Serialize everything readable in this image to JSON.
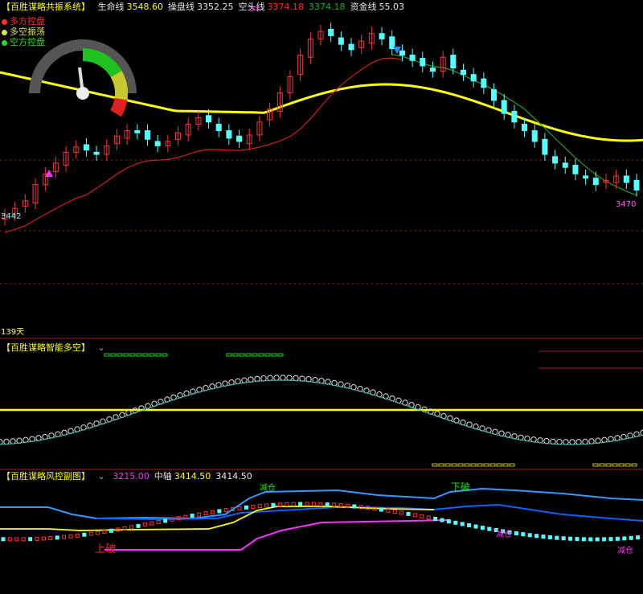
{
  "colors": {
    "up": "#ff3232",
    "down": "#54ffff",
    "life": "#ff3232",
    "op": "#e8e8e8",
    "short": "#ff3232",
    "money": "#00d000",
    "yellow": "#ffff00",
    "fund": "#20c020",
    "mag": "#ff30ff",
    "blue": "#1060ff",
    "lblue": "#3399ff",
    "grid": "#ff3232"
  },
  "main": {
    "title": "【百胜谋略共振系统】",
    "indicators": [
      {
        "name": "生命线",
        "value": "3548.60",
        "color": "#ffff00"
      },
      {
        "name": "操盘线",
        "value": "3352.25",
        "color": "#e8e8e8"
      },
      {
        "name": "空头线",
        "value": "3374.18",
        "color": "#ff3232"
      },
      {
        "name": "",
        "value": "3374.18",
        "color": "#00c000"
      },
      {
        "name": "资金线",
        "value": "55.03",
        "color": "#e8e8e8"
      }
    ],
    "legend": [
      {
        "label": "多方控盘",
        "color": "#ff3030",
        "dot": "#ff3030"
      },
      {
        "label": "多空振荡",
        "color": "#e0e060",
        "dot": "#e0e060"
      },
      {
        "label": "空方控盘",
        "color": "#20e020",
        "dot": "#20e020"
      }
    ],
    "low_label": "3442",
    "high_label": "3470",
    "peak_mark": "3↓",
    "days_label": "139天"
  },
  "sub1": {
    "title": "【百胜谋略智能多空】"
  },
  "sub2": {
    "title": "【百胜谋略风控副图】",
    "indicators": [
      {
        "name": "",
        "value": "3215.00",
        "color": "#ff30ff"
      },
      {
        "name": "中轴",
        "value": "3414.50",
        "color": "#ffff00"
      },
      {
        "name": "",
        "value": "3414.50",
        "color": "#e8e8e8"
      }
    ],
    "annotations": [
      {
        "text": "上破",
        "color": "#ff2020"
      },
      {
        "text": "减仓",
        "color": "#20e020"
      },
      {
        "text": "下破",
        "color": "#20e020"
      },
      {
        "text": "减仓",
        "color": "#ff30ff"
      },
      {
        "text": "减仓",
        "color": "#ff30ff"
      }
    ]
  },
  "chart_data": {
    "type": "candlestick",
    "days": "139天",
    "candles_close_trend": [
      3442,
      3448,
      3455,
      3470,
      3480,
      3490,
      3500,
      3505,
      3502,
      3498,
      3506,
      3515,
      3520,
      3518,
      3512,
      3506,
      3510,
      3518,
      3526,
      3532,
      3528,
      3520,
      3513,
      3510,
      3516,
      3528,
      3540,
      3555,
      3570,
      3590,
      3605,
      3612,
      3608,
      3600,
      3595,
      3603,
      3610,
      3605,
      3596,
      3590,
      3585,
      3580,
      3575,
      3588,
      3578,
      3572,
      3566,
      3560,
      3548,
      3536,
      3528,
      3520,
      3510,
      3498,
      3490,
      3486,
      3480,
      3476,
      3470,
      3474,
      3478,
      3472,
      3465
    ],
    "life_line_last": 3548.6,
    "operate_line_last": 3352.25,
    "short_line_last": 3374.18,
    "fund_line_last": 55.03
  }
}
